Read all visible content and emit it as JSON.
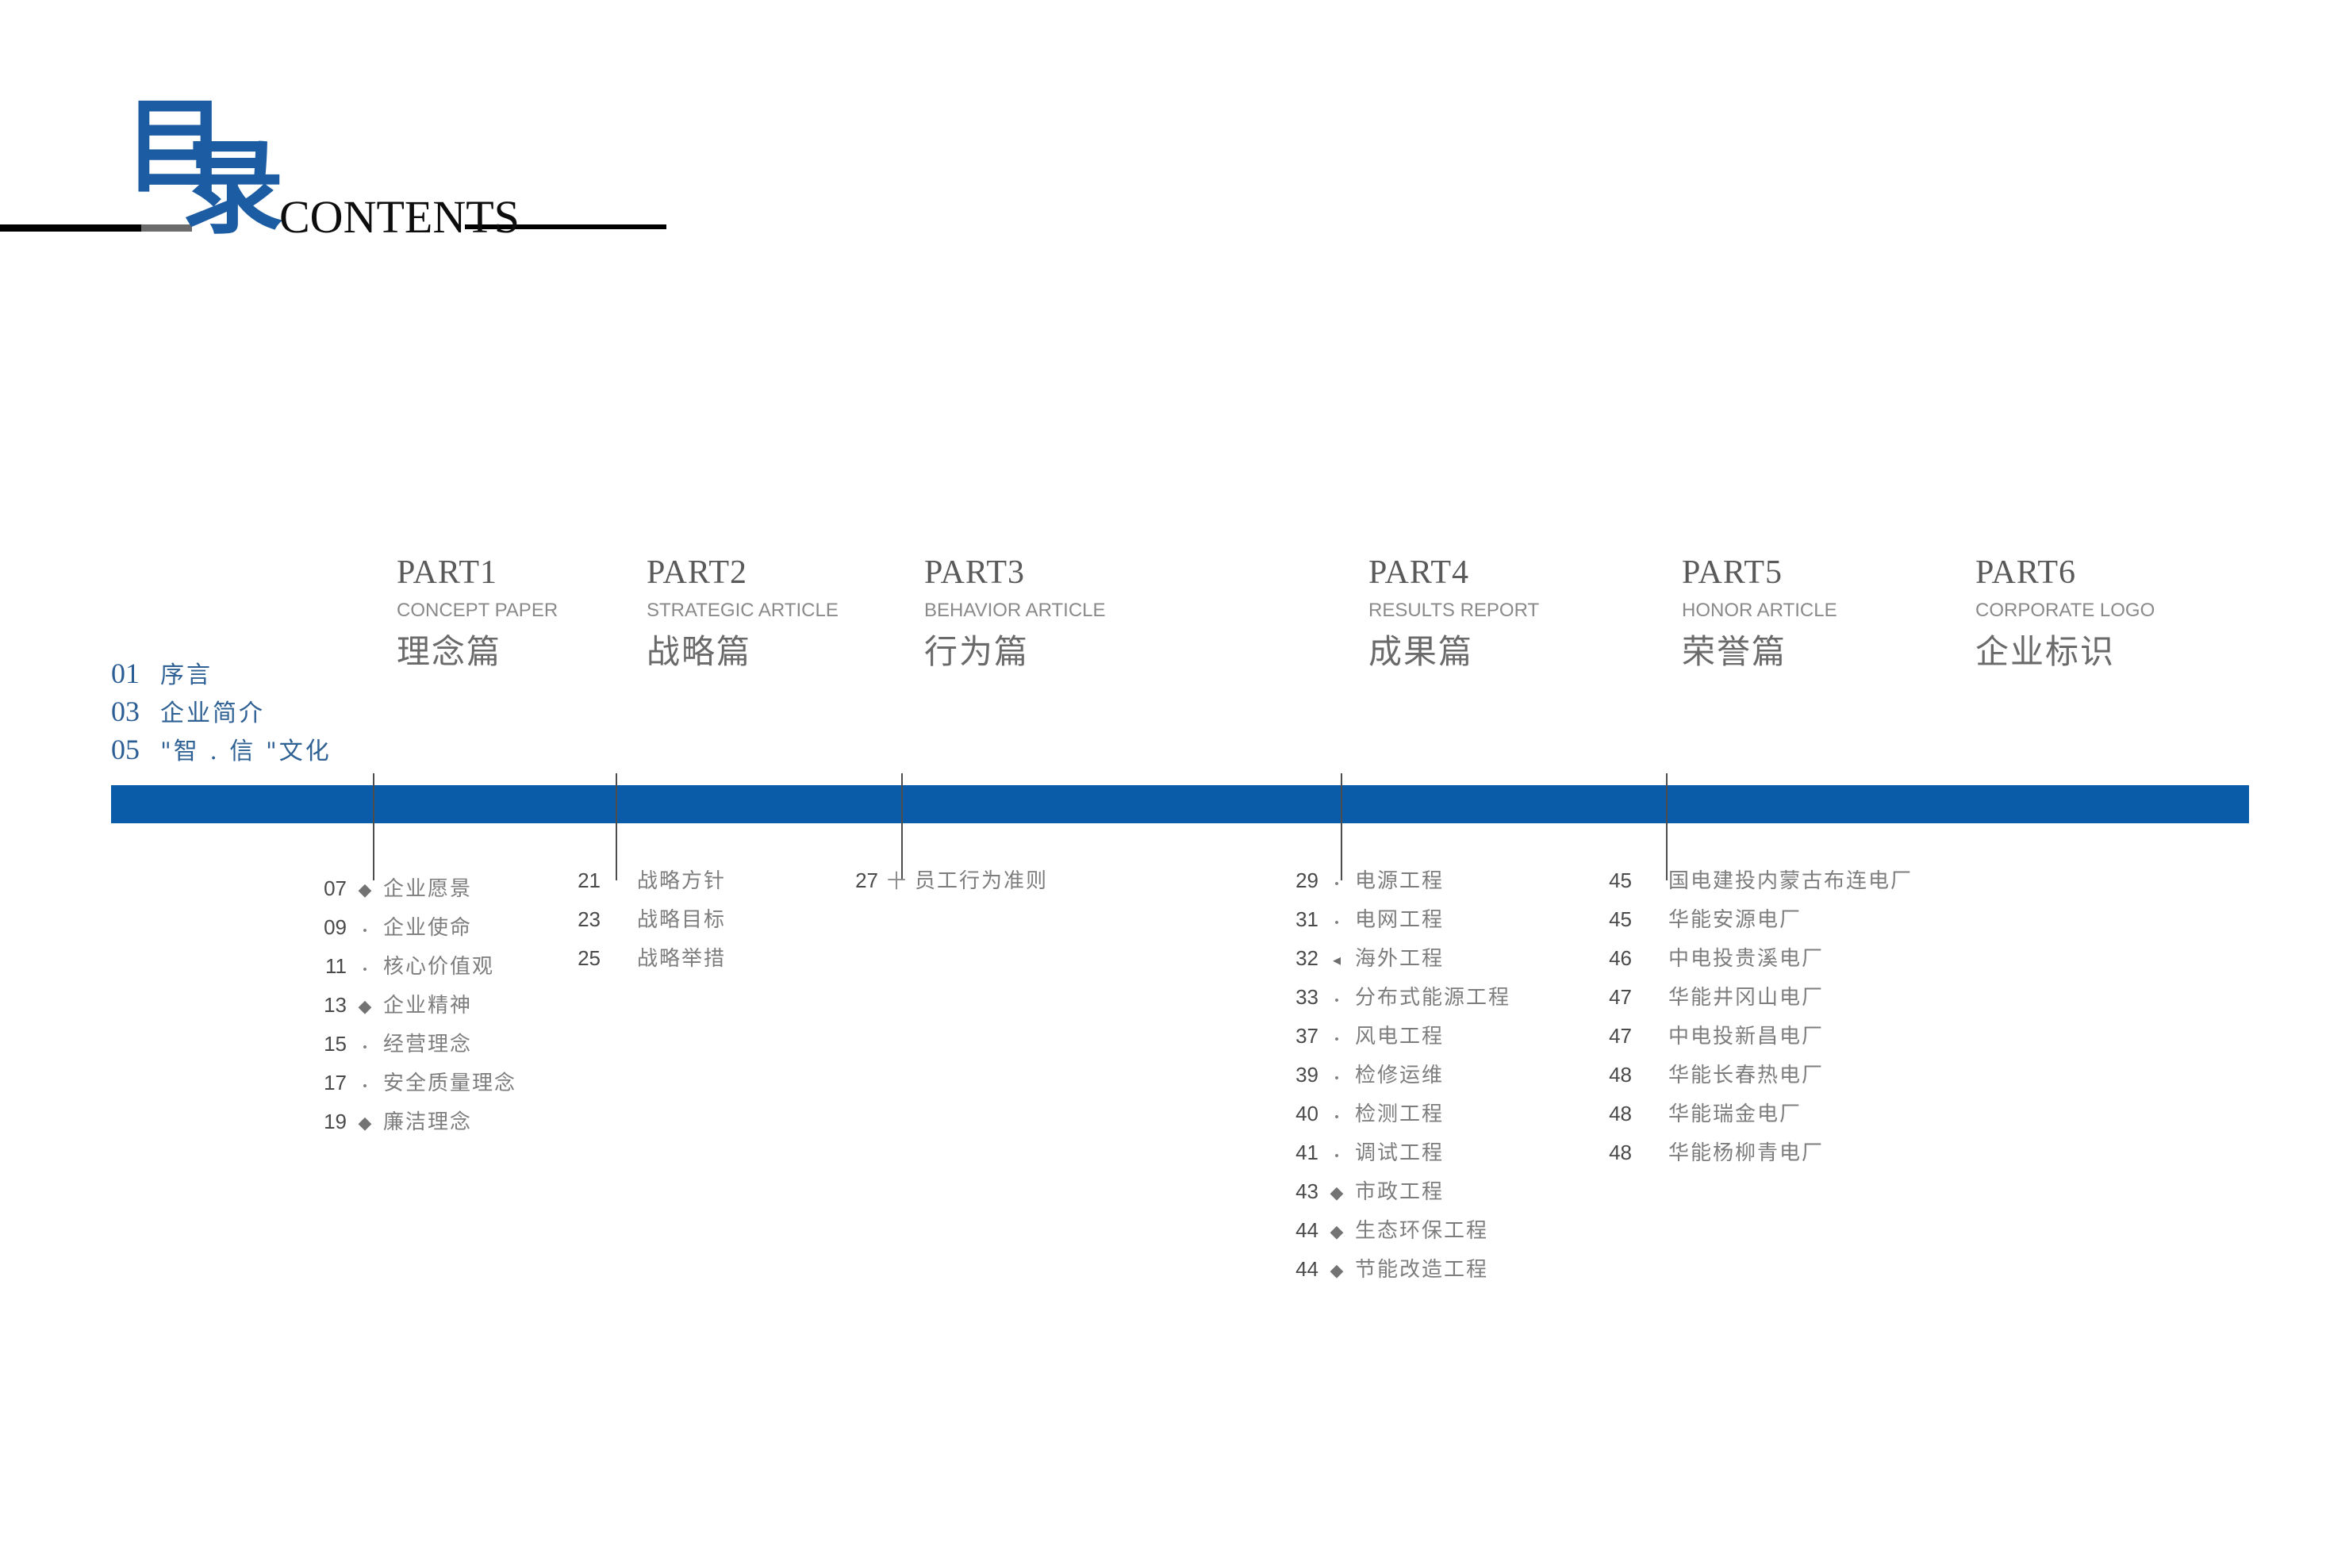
{
  "header": {
    "title_cn_char1": "目",
    "title_cn_char2": "录",
    "title_en": "CONTENTS",
    "accent_blue": "#1c5ca3",
    "bar_blue": "#0a5ca8"
  },
  "left_items": [
    {
      "num": "01",
      "label": "序言"
    },
    {
      "num": "03",
      "label": "企业简介"
    },
    {
      "num": "05",
      "label": "\"智 . 信 \"文化"
    }
  ],
  "parts": [
    {
      "num": "PART1",
      "en": "CONCEPT PAPER",
      "cn": "理念篇",
      "items": [
        {
          "num": "07",
          "bullet": "diamond",
          "label": "企业愿景"
        },
        {
          "num": "09",
          "bullet": "dot",
          "label": "企业使命"
        },
        {
          "num": "11",
          "bullet": "dot",
          "label": "核心价值观"
        },
        {
          "num": "13",
          "bullet": "diamond",
          "label": "企业精神"
        },
        {
          "num": "15",
          "bullet": "dot",
          "label": "经营理念"
        },
        {
          "num": "17",
          "bullet": "dot",
          "label": "安全质量理念"
        },
        {
          "num": "19",
          "bullet": "diamond",
          "label": "廉洁理念"
        }
      ]
    },
    {
      "num": "PART2",
      "en": "STRATEGIC ARTICLE",
      "cn": "战略篇",
      "items": [
        {
          "num": "21",
          "bullet": "none",
          "label": "战略方针"
        },
        {
          "num": "23",
          "bullet": "none",
          "label": "战略目标"
        },
        {
          "num": "25",
          "bullet": "none",
          "label": "战略举措"
        }
      ]
    },
    {
      "num": "PART3",
      "en": "BEHAVIOR ARTICLE",
      "cn": "行为篇",
      "items": [
        {
          "num": "27",
          "bullet": "plus",
          "label": "员工行为准则"
        }
      ]
    },
    {
      "num": "PART4",
      "en": "RESULTS REPORT",
      "cn": "成果篇",
      "items": [
        {
          "num": "29",
          "bullet": "dot",
          "label": "电源工程"
        },
        {
          "num": "31",
          "bullet": "dot",
          "label": "电网工程"
        },
        {
          "num": "32",
          "bullet": "tri",
          "label": "海外工程"
        },
        {
          "num": "33",
          "bullet": "dot",
          "label": "分布式能源工程"
        },
        {
          "num": "37",
          "bullet": "dot",
          "label": "风电工程"
        },
        {
          "num": "39",
          "bullet": "dot",
          "label": "检修运维"
        },
        {
          "num": "40",
          "bullet": "dot",
          "label": "检测工程"
        },
        {
          "num": "41",
          "bullet": "dot",
          "label": "调试工程"
        },
        {
          "num": "43",
          "bullet": "diamond",
          "label": "市政工程"
        },
        {
          "num": "44",
          "bullet": "diamond",
          "label": "生态环保工程"
        },
        {
          "num": "44",
          "bullet": "diamond",
          "label": "节能改造工程"
        }
      ]
    },
    {
      "num": "PART5",
      "en": "HONOR ARTICLE",
      "cn": "荣誉篇",
      "items": [
        {
          "num": "45",
          "bullet": "none",
          "label": "国电建投内蒙古布连电厂"
        },
        {
          "num": "45",
          "bullet": "none",
          "label": "华能安源电厂"
        },
        {
          "num": "46",
          "bullet": "none",
          "label": "中电投贵溪电厂"
        },
        {
          "num": "47",
          "bullet": "none",
          "label": "华能井冈山电厂"
        },
        {
          "num": "47",
          "bullet": "none",
          "label": "中电投新昌电厂"
        },
        {
          "num": "48",
          "bullet": "none",
          "label": "华能长春热电厂"
        },
        {
          "num": "48",
          "bullet": "none",
          "label": "华能瑞金电厂"
        },
        {
          "num": "48",
          "bullet": "none",
          "label": "华能杨柳青电厂"
        }
      ]
    },
    {
      "num": "PART6",
      "en": "CORPORATE LOGO",
      "cn": "企业标识",
      "items": []
    }
  ]
}
